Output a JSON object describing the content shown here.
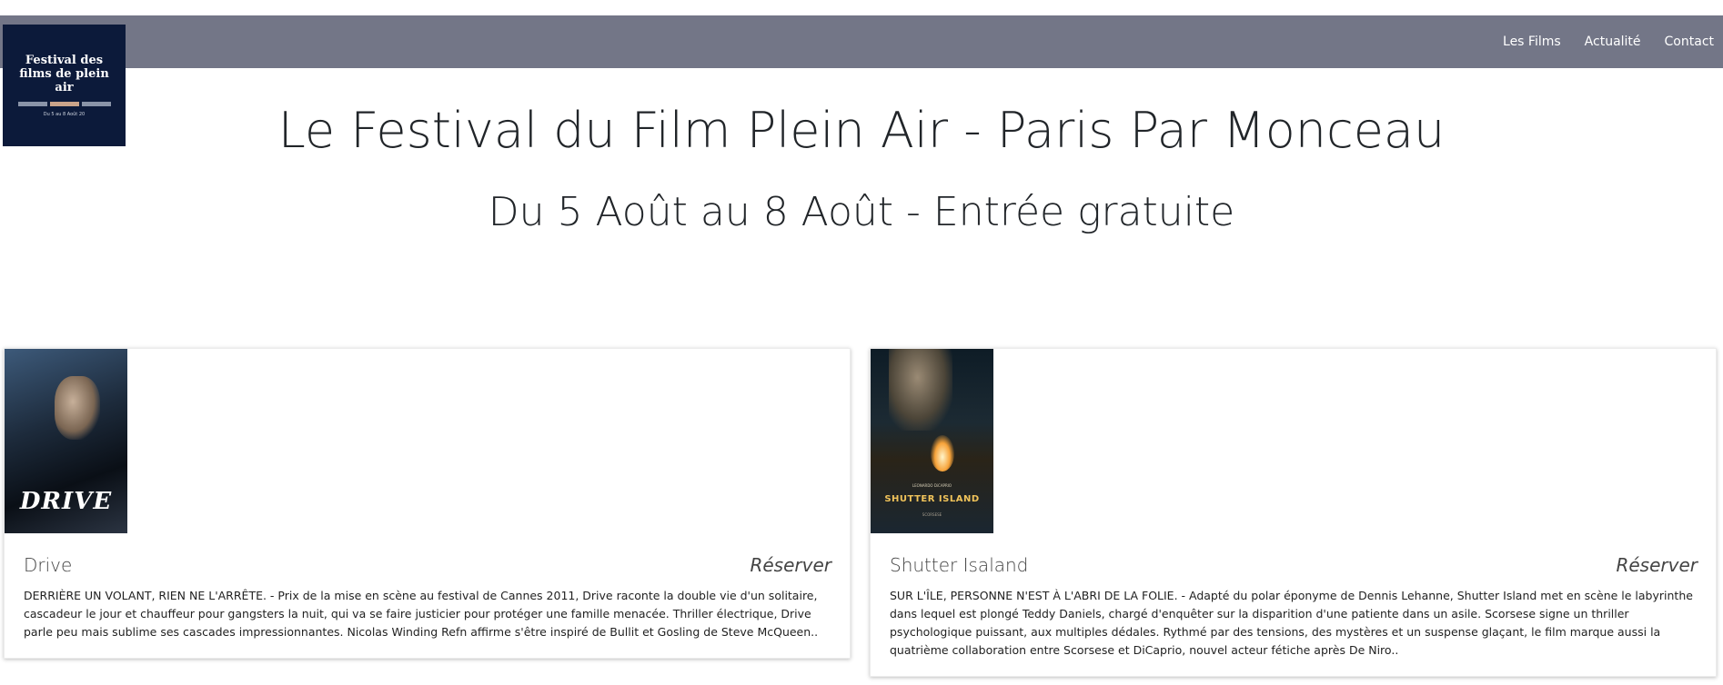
{
  "logo": {
    "title": "Festival des films de plein air",
    "subtitle": "Du 5 au 8 Août 20"
  },
  "nav": {
    "items": [
      {
        "label": "Les Films"
      },
      {
        "label": "Actualité"
      },
      {
        "label": "Contact"
      }
    ]
  },
  "hero": {
    "title": "Le Festival du Film Plein Air - Paris Par Monceau",
    "subtitle": "Du 5 Août au 8 Août - Entrée gratuite"
  },
  "films": [
    {
      "title": "Drive",
      "reserve_label": "Réserver",
      "poster_text": "DRIVE",
      "description": "DERRIÈRE UN VOLANT, RIEN NE L'ARRÊTE. - Prix de la mise en scène au festival de Cannes 2011, Drive raconte la double vie d'un solitaire, cascadeur le jour et chauffeur pour gangsters la nuit, qui va se faire justicier pour protéger une famille menacée. Thriller électrique, Drive parle peu mais sublime ses cascades impressionnantes. Nicolas Winding Refn affirme s'être inspiré de Bullit et Gosling de Steve McQueen.."
    },
    {
      "title": "Shutter Isaland",
      "reserve_label": "Réserver",
      "poster_text": "SHUTTER ISLAND",
      "poster_small": "LEONARDO DiCAPRIO",
      "poster_credit": "SCORSESE",
      "description": "SUR L'ÎLE, PERSONNE N'EST À L'ABRI DE LA FOLIE. - Adapté du polar éponyme de Dennis Lehanne, Shutter Island met en scène le labyrinthe dans lequel est plongé Teddy Daniels, chargé d'enquêter sur la disparition d'une patiente dans un asile. Scorsese signe un thriller psychologique puissant, aux multiples dédales. Rythmé par des tensions, des mystères et un suspense glaçant, le film marque aussi la quatrième collaboration entre Scorsese et DiCaprio, nouvel acteur fétiche après De Niro.."
    }
  ],
  "colors": {
    "navbar": "#737687",
    "logo_bg": "#0c1a3a"
  }
}
